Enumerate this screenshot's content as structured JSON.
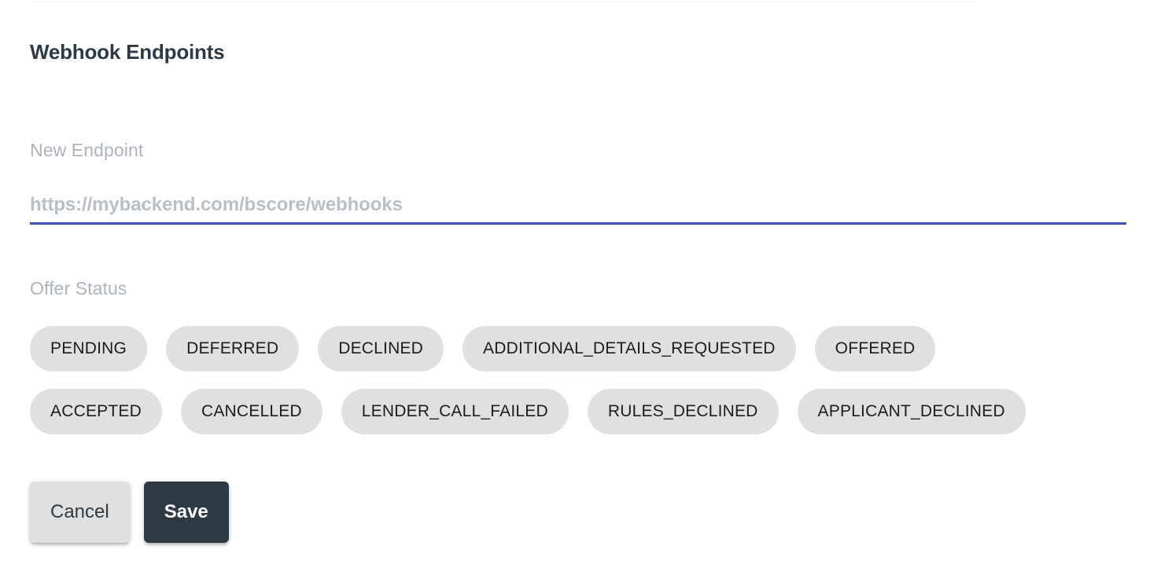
{
  "panel": {
    "title": "Webhook Endpoints"
  },
  "endpoint_field": {
    "label": "New Endpoint",
    "value": "",
    "placeholder": "https://mybackend.com/bscore/webhooks",
    "underline_color": "#3f51b5"
  },
  "offer_status": {
    "label": "Offer Status",
    "chip_bg_color": "#e0e0e0",
    "rows": [
      [
        {
          "label": "PENDING"
        },
        {
          "label": "DEFERRED"
        },
        {
          "label": "DECLINED"
        },
        {
          "label": "ADDITIONAL_DETAILS_REQUESTED"
        },
        {
          "label": "OFFERED"
        }
      ],
      [
        {
          "label": "ACCEPTED"
        },
        {
          "label": "CANCELLED"
        },
        {
          "label": "LENDER_CALL_FAILED"
        },
        {
          "label": "RULES_DECLINED"
        },
        {
          "label": "APPLICANT_DECLINED"
        }
      ]
    ]
  },
  "actions": {
    "cancel_label": "Cancel",
    "save_label": "Save",
    "save_bg_color": "#2d3a43",
    "cancel_bg_color": "#e0e0e0"
  }
}
